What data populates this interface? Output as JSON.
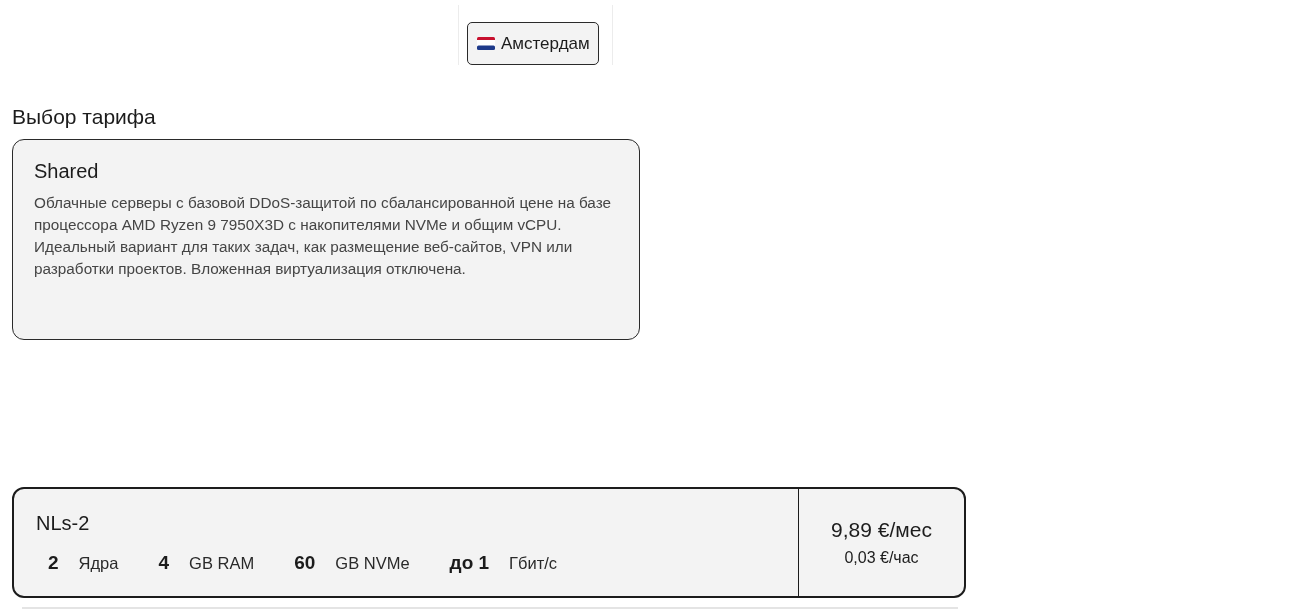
{
  "location": {
    "label": "Амстердам"
  },
  "tariff_section": {
    "title": "Выбор тарифа",
    "tariff": {
      "title": "Shared",
      "description": "Облачные серверы с базовой DDoS-защитой по сбалансированной цене на базе процессора AMD Ryzen 9 7950X3D с накопителями NVMe и общим vCPU. Идеальный вариант для таких задач, как размещение веб-сайтов, VPN или разработки проектов. Вложенная виртуализация отключена."
    }
  },
  "plans": [
    {
      "name": "NLs-2",
      "specs": [
        {
          "value": "2",
          "unit": "Ядра"
        },
        {
          "value": "4",
          "unit": "GB RAM"
        },
        {
          "value": "60",
          "unit": "GB NVMe"
        },
        {
          "value": "до 1",
          "unit": "Гбит/с"
        }
      ],
      "price_month": "9,89 €/мес",
      "price_hour": "0,03 €/час"
    }
  ]
}
